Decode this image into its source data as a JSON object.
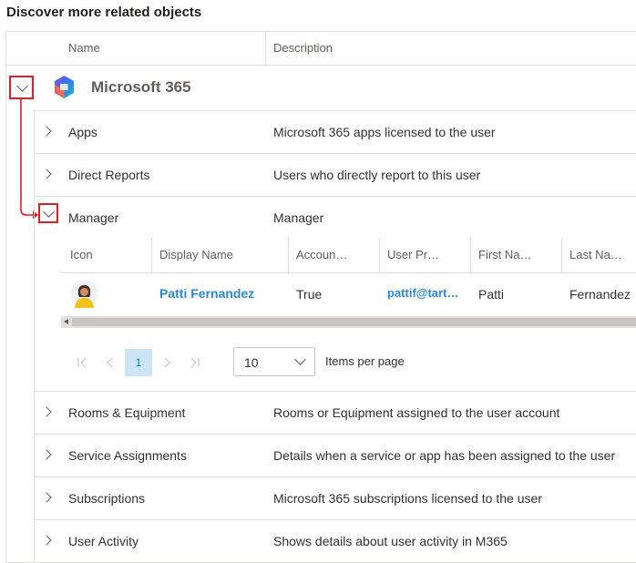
{
  "page": {
    "title": "Discover more related objects"
  },
  "table": {
    "col_name": "Name",
    "col_description": "Description"
  },
  "group": {
    "name": "Microsoft 365"
  },
  "rows": [
    {
      "name": "Apps",
      "description": "Microsoft 365 apps licensed to the user"
    },
    {
      "name": "Direct Reports",
      "description": "Users who directly report to this user"
    },
    {
      "name": "Manager",
      "description": "Manager"
    },
    {
      "name": "Rooms & Equipment",
      "description": "Rooms or Equipment assigned to the user account"
    },
    {
      "name": "Service Assignments",
      "description": "Details when a service or app has been assigned to the user"
    },
    {
      "name": "Subscriptions",
      "description": "Microsoft 365 subscriptions licensed to the user"
    },
    {
      "name": "User Activity",
      "description": "Shows details about user activity in M365"
    }
  ],
  "manager": {
    "headers": [
      "Icon",
      "Display Name",
      "Accoun…",
      "User Pr…",
      "First Na…",
      "Last Na…"
    ],
    "row": {
      "display_name": "Patti Fernandez",
      "account": "True",
      "upn": "pattif@tart…",
      "first": "Patti",
      "last": "Fernandez"
    },
    "pagination": {
      "current_page": "1",
      "page_size": "10",
      "items_per_page_label": "Items per page"
    }
  },
  "colors": {
    "accent": "#0078d4",
    "annotation": "#e01e2a",
    "link": "#2b88d8"
  },
  "icons": [
    "chevron-right-icon",
    "chevron-down-icon",
    "microsoft-365-logo",
    "first-page-icon",
    "prev-page-icon",
    "next-page-icon",
    "last-page-icon"
  ]
}
